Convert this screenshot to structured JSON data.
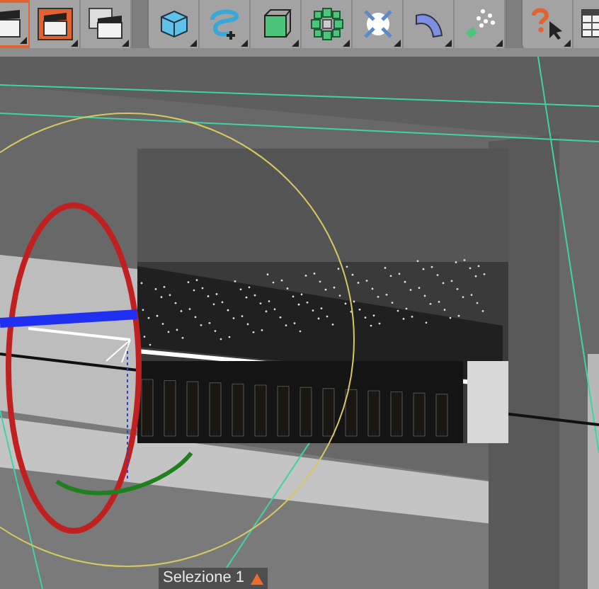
{
  "toolbar": {
    "groups": [
      {
        "buttons": [
          {
            "kind": "clapper",
            "selected": true
          },
          {
            "kind": "render-clapper",
            "selected": false
          },
          {
            "kind": "render-settings",
            "selected": false
          }
        ]
      },
      {
        "buttons": [
          {
            "kind": "cube",
            "selected": false
          },
          {
            "kind": "spline",
            "selected": false
          },
          {
            "kind": "box-points",
            "selected": false
          },
          {
            "kind": "cloner",
            "selected": false
          },
          {
            "kind": "arrows",
            "selected": false
          },
          {
            "kind": "bend",
            "selected": false
          },
          {
            "kind": "particles",
            "selected": false
          }
        ]
      },
      {
        "buttons": [
          {
            "kind": "help",
            "selected": false
          },
          {
            "kind": "table-help",
            "selected": false
          }
        ]
      }
    ]
  },
  "viewport": {
    "selection_label": "Selezione 1"
  }
}
